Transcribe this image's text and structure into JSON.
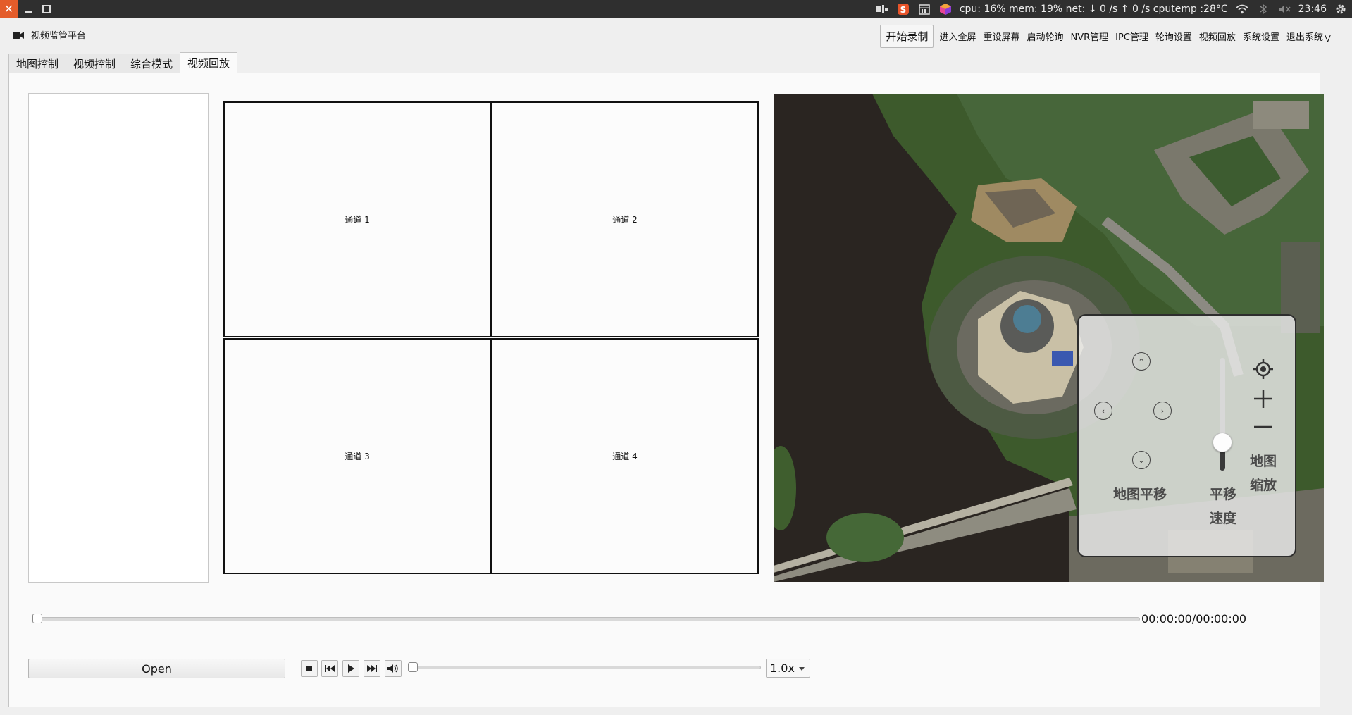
{
  "system_bar": {
    "close_glyph": "✕",
    "stats": "cpu: 16% mem: 19% net: ↓   0 /s ↑   0 /s cputemp :28°C",
    "clock": "23:46"
  },
  "app": {
    "title": "视频监管平台"
  },
  "topmenu": {
    "record": "开始录制",
    "items": [
      "进入全屏",
      "重设屏幕",
      "启动轮询",
      "NVR管理",
      "IPC管理",
      "轮询设置",
      "视频回放",
      "系统设置",
      "退出系统"
    ]
  },
  "tabs": [
    "地图控制",
    "视频控制",
    "综合模式",
    "视频回放"
  ],
  "channels": [
    "通道 1",
    "通道 2",
    "通道 3",
    "通道 4"
  ],
  "map_control": {
    "pan_label": "地图平移",
    "speed_label_1": "平移",
    "speed_label_2": "速度",
    "zoom_label_1": "地图",
    "zoom_label_2": "缩放",
    "speed_level": 0.25
  },
  "playback": {
    "time": "00:00:00/00:00:00",
    "open_label": "Open",
    "speed": "1.0x",
    "progress": 0
  }
}
